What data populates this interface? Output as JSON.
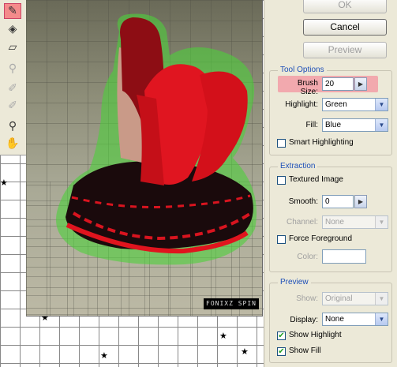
{
  "toolbox": {
    "tools": [
      {
        "name": "edge-highlighter-tool",
        "glyph": "✎",
        "selected": true
      },
      {
        "name": "fill-tool",
        "glyph": "◈",
        "selected": false
      },
      {
        "name": "eraser-tool",
        "glyph": "▱",
        "selected": false
      },
      {
        "name": "eyedropper-tool",
        "glyph": "⚲",
        "selected": false,
        "disabled": true
      },
      {
        "name": "cleanup-tool",
        "glyph": "✐",
        "selected": false,
        "disabled": true
      },
      {
        "name": "edge-touchup-tool",
        "glyph": "✐",
        "selected": false,
        "disabled": true
      },
      {
        "name": "zoom-tool",
        "glyph": "🔍",
        "selected": false
      },
      {
        "name": "hand-tool",
        "glyph": "✋",
        "selected": false
      }
    ]
  },
  "canvas": {
    "watermark": "FONIXZ SPIN"
  },
  "buttons": {
    "ok": "OK",
    "cancel": "Cancel",
    "preview": "Preview"
  },
  "tool_options": {
    "legend": "Tool Options",
    "brush_size_label": "Brush Size:",
    "brush_size_value": "20",
    "highlight_label": "Highlight:",
    "highlight_value": "Green",
    "fill_label": "Fill:",
    "fill_value": "Blue",
    "smart_highlighting_label": "Smart Highlighting",
    "smart_highlighting_checked": false
  },
  "extraction": {
    "legend": "Extraction",
    "textured_image_label": "Textured Image",
    "textured_image_checked": false,
    "smooth_label": "Smooth:",
    "smooth_value": "0",
    "channel_label": "Channel:",
    "channel_value": "None",
    "force_foreground_label": "Force Foreground",
    "force_foreground_checked": false,
    "color_label": "Color:"
  },
  "preview": {
    "legend": "Preview",
    "show_label": "Show:",
    "show_value": "Original",
    "display_label": "Display:",
    "display_value": "None",
    "show_highlight_label": "Show Highlight",
    "show_highlight_checked": true,
    "show_fill_label": "Show Fill",
    "show_fill_checked": true
  },
  "colors": {
    "highlight_green": "#4cd13a",
    "selected_tool": "#f48b8b",
    "brush_highlight": "#f2a9ae",
    "group_legend": "#1d4fb8"
  }
}
